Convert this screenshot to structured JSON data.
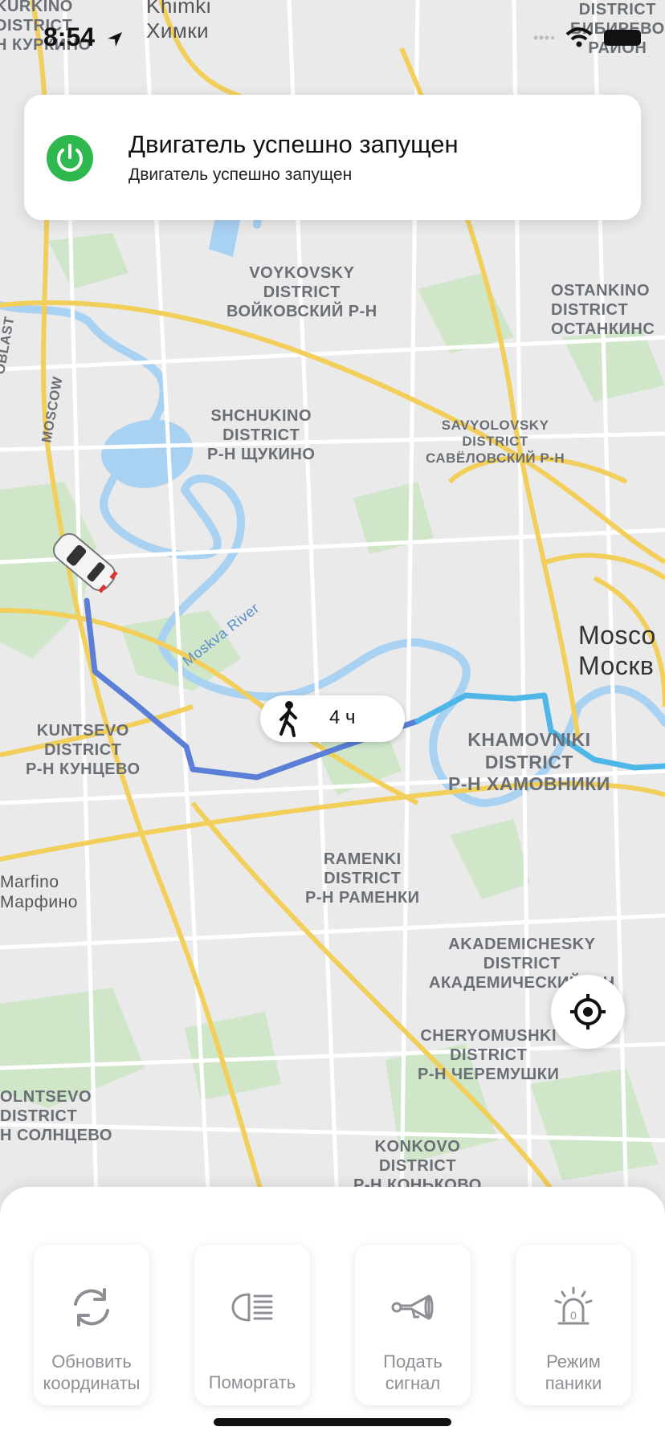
{
  "status_bar": {
    "time": "8:54"
  },
  "notification": {
    "title": "Двигатель успешно запущен",
    "body": "Двигатель успешно запущен",
    "icon": "power-icon",
    "icon_color": "#2fb84e"
  },
  "map": {
    "route_color": "#4a90e2",
    "walk_duration": "4 ч",
    "labels": {
      "khimki": [
        "Khimki",
        "Химки"
      ],
      "khimki_corner": [
        "KURKINO",
        "DISTRICT",
        "Н КУРКИНО"
      ],
      "bibirevo": [
        "DISTRICT",
        "БИБИРЕВО",
        "РАЙОН"
      ],
      "voykovsky": [
        "VOYKOVSKY",
        "DISTRICT",
        "ВОЙКОВСКИЙ Р-Н"
      ],
      "ostankino": [
        "OSTANKINO",
        "DISTRICT",
        "ОСТАНКИНС"
      ],
      "shchukino": [
        "SHCHUKINO",
        "DISTRICT",
        "Р-Н ЩУКИНО"
      ],
      "savyolovsky": [
        "SAVYOLOVSKY",
        "DISTRICT",
        "САВЁЛОВСКИЙ Р-Н"
      ],
      "moscow_city": [
        "Mosco",
        "Москв"
      ],
      "kuntsevo": [
        "KUNTSEVO",
        "DISTRICT",
        "Р-Н КУНЦЕВО"
      ],
      "khamovniki": [
        "KHAMOVNIKI",
        "DISTRICT",
        "Р-Н ХАМОВНИКИ"
      ],
      "ramenki": [
        "RAMENKI",
        "DISTRICT",
        "Р-Н РАМЕНКИ"
      ],
      "marfino": [
        "Marfino",
        "Марфино"
      ],
      "akademichesky": [
        "AKADEMICHESKY",
        "DISTRICT",
        "АКАДЕМИЧЕСКИЙ Р-Н"
      ],
      "cheryomushki": [
        "CHERYOMUSHKI",
        "DISTRICT",
        "Р-Н ЧЕРЕМУШКИ"
      ],
      "solntsevo": [
        "OLNTSEVO",
        "DISTRICT",
        "Н СОЛНЦЕВО"
      ],
      "konkovo": [
        "KONKOVO",
        "DISTRICT",
        "Р-Н КОНЬКОВО"
      ],
      "moskva_river": "Moskva River",
      "moscow_oblast": "MOSCOW",
      "oblast": "OBLAST"
    }
  },
  "actions": [
    {
      "label_line1": "Обновить",
      "label_line2": "координаты",
      "icon": "refresh-icon"
    },
    {
      "label_line1": "",
      "label_line2": "Поморгать",
      "icon": "headlight-icon"
    },
    {
      "label_line1": "Подать",
      "label_line2": "сигнал",
      "icon": "horn-icon"
    },
    {
      "label_line1": "Режим",
      "label_line2": "паники",
      "icon": "alarm-beacon-icon"
    }
  ]
}
